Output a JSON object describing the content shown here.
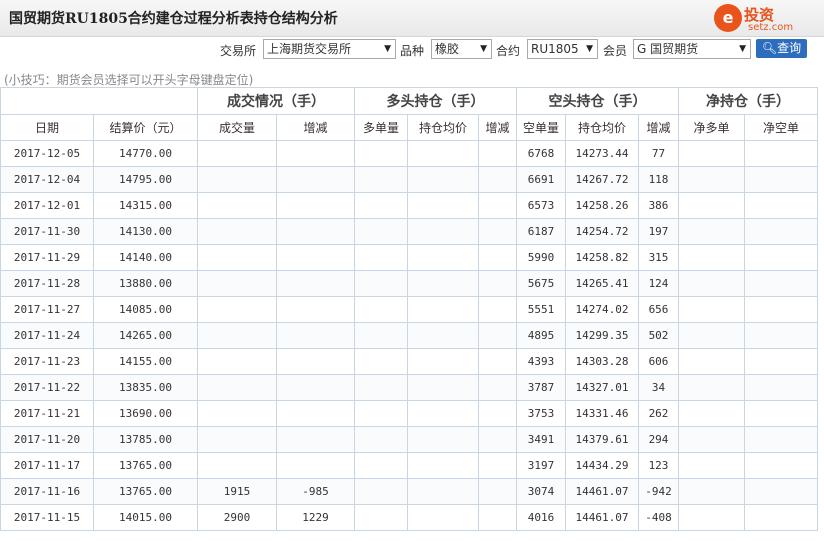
{
  "header": {
    "title": "国贸期货RU1805合约建仓过程分析表持仓结构分析",
    "logo_mark": "e",
    "logo_text": "投资",
    "logo_sub": "setz.com"
  },
  "filters": {
    "exchange_label": "交易所",
    "exchange_value": "上海期货交易所",
    "variety_label": "品种",
    "variety_value": "橡胶",
    "contract_label": "合约",
    "contract_value": "RU1805",
    "member_label": "会员",
    "member_value": "G 国贸期货",
    "query_label": "查询"
  },
  "tip": "(小技巧：期货会员选择可以开头字母键盘定位)",
  "table": {
    "groups": [
      "成交情况（手）",
      "多头持仓（手）",
      "空头持仓（手）",
      "净持仓（手）"
    ],
    "columns": [
      "日期",
      "结算价（元）",
      "成交量",
      "增减",
      "多单量",
      "持仓均价",
      "增减",
      "空单量",
      "持仓均价",
      "增减",
      "净多单",
      "净空单"
    ],
    "rows": [
      {
        "date": "2017-12-05",
        "settle": "14770.00",
        "vol": "",
        "vol_chg": "",
        "long": "",
        "long_avg": "",
        "long_chg": "",
        "short": "6768",
        "short_avg": "14273.44",
        "short_chg": "77",
        "net_long": "",
        "net_short": ""
      },
      {
        "date": "2017-12-04",
        "settle": "14795.00",
        "vol": "",
        "vol_chg": "",
        "long": "",
        "long_avg": "",
        "long_chg": "",
        "short": "6691",
        "short_avg": "14267.72",
        "short_chg": "118",
        "net_long": "",
        "net_short": ""
      },
      {
        "date": "2017-12-01",
        "settle": "14315.00",
        "vol": "",
        "vol_chg": "",
        "long": "",
        "long_avg": "",
        "long_chg": "",
        "short": "6573",
        "short_avg": "14258.26",
        "short_chg": "386",
        "net_long": "",
        "net_short": ""
      },
      {
        "date": "2017-11-30",
        "settle": "14130.00",
        "vol": "",
        "vol_chg": "",
        "long": "",
        "long_avg": "",
        "long_chg": "",
        "short": "6187",
        "short_avg": "14254.72",
        "short_chg": "197",
        "net_long": "",
        "net_short": ""
      },
      {
        "date": "2017-11-29",
        "settle": "14140.00",
        "vol": "",
        "vol_chg": "",
        "long": "",
        "long_avg": "",
        "long_chg": "",
        "short": "5990",
        "short_avg": "14258.82",
        "short_chg": "315",
        "net_long": "",
        "net_short": ""
      },
      {
        "date": "2017-11-28",
        "settle": "13880.00",
        "vol": "",
        "vol_chg": "",
        "long": "",
        "long_avg": "",
        "long_chg": "",
        "short": "5675",
        "short_avg": "14265.41",
        "short_chg": "124",
        "net_long": "",
        "net_short": ""
      },
      {
        "date": "2017-11-27",
        "settle": "14085.00",
        "vol": "",
        "vol_chg": "",
        "long": "",
        "long_avg": "",
        "long_chg": "",
        "short": "5551",
        "short_avg": "14274.02",
        "short_chg": "656",
        "net_long": "",
        "net_short": ""
      },
      {
        "date": "2017-11-24",
        "settle": "14265.00",
        "vol": "",
        "vol_chg": "",
        "long": "",
        "long_avg": "",
        "long_chg": "",
        "short": "4895",
        "short_avg": "14299.35",
        "short_chg": "502",
        "net_long": "",
        "net_short": ""
      },
      {
        "date": "2017-11-23",
        "settle": "14155.00",
        "vol": "",
        "vol_chg": "",
        "long": "",
        "long_avg": "",
        "long_chg": "",
        "short": "4393",
        "short_avg": "14303.28",
        "short_chg": "606",
        "net_long": "",
        "net_short": ""
      },
      {
        "date": "2017-11-22",
        "settle": "13835.00",
        "vol": "",
        "vol_chg": "",
        "long": "",
        "long_avg": "",
        "long_chg": "",
        "short": "3787",
        "short_avg": "14327.01",
        "short_chg": "34",
        "net_long": "",
        "net_short": ""
      },
      {
        "date": "2017-11-21",
        "settle": "13690.00",
        "vol": "",
        "vol_chg": "",
        "long": "",
        "long_avg": "",
        "long_chg": "",
        "short": "3753",
        "short_avg": "14331.46",
        "short_chg": "262",
        "net_long": "",
        "net_short": ""
      },
      {
        "date": "2017-11-20",
        "settle": "13785.00",
        "vol": "",
        "vol_chg": "",
        "long": "",
        "long_avg": "",
        "long_chg": "",
        "short": "3491",
        "short_avg": "14379.61",
        "short_chg": "294",
        "net_long": "",
        "net_short": ""
      },
      {
        "date": "2017-11-17",
        "settle": "13765.00",
        "vol": "",
        "vol_chg": "",
        "long": "",
        "long_avg": "",
        "long_chg": "",
        "short": "3197",
        "short_avg": "14434.29",
        "short_chg": "123",
        "net_long": "",
        "net_short": ""
      },
      {
        "date": "2017-11-16",
        "settle": "13765.00",
        "vol": "1915",
        "vol_chg": "-985",
        "long": "",
        "long_avg": "",
        "long_chg": "",
        "short": "3074",
        "short_avg": "14461.07",
        "short_chg": "-942",
        "net_long": "",
        "net_short": ""
      },
      {
        "date": "2017-11-15",
        "settle": "14015.00",
        "vol": "2900",
        "vol_chg": "1229",
        "long": "",
        "long_avg": "",
        "long_chg": "",
        "short": "4016",
        "short_avg": "14461.07",
        "short_chg": "-408",
        "net_long": "",
        "net_short": ""
      }
    ]
  },
  "colors": {
    "positive": "#e60000",
    "negative": "#2a9d2a",
    "accent": "#2d6dbd",
    "brand": "#e8541c"
  },
  "icons": {
    "query": "search-icon",
    "select_arrow": "triangle-down"
  }
}
